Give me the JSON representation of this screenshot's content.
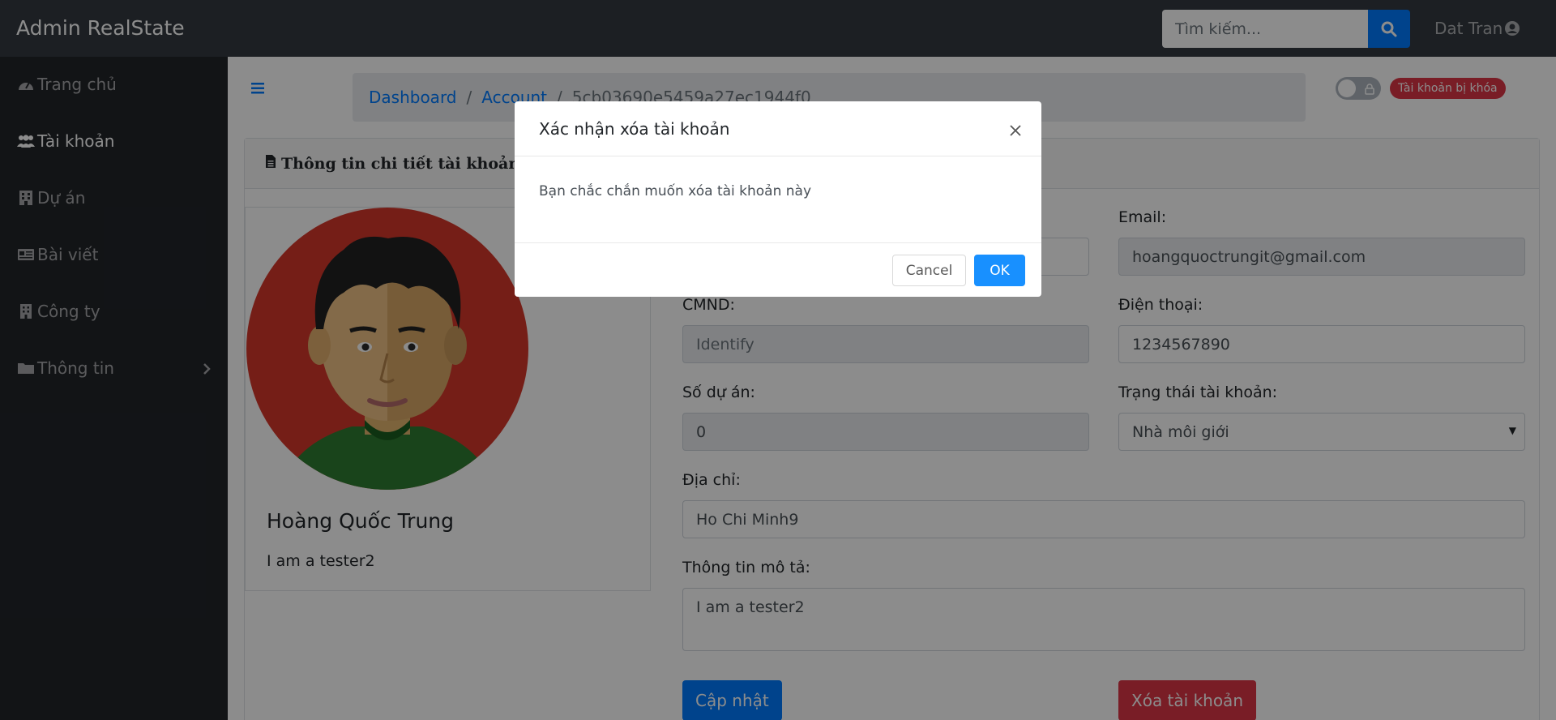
{
  "navbar": {
    "brand": "Admin RealState",
    "search_placeholder": "Tìm kiếm...",
    "user_name": "Dat Tran"
  },
  "sidebar": {
    "items": [
      {
        "label": "Trang chủ",
        "icon": "tachometer-icon"
      },
      {
        "label": "Tài khoản",
        "icon": "users-icon",
        "active": true
      },
      {
        "label": "Dự án",
        "icon": "building-icon"
      },
      {
        "label": "Bài viết",
        "icon": "newspaper-icon"
      },
      {
        "label": "Công ty",
        "icon": "company-icon"
      },
      {
        "label": "Thông tin",
        "icon": "folder-icon",
        "has_submenu": true
      }
    ]
  },
  "breadcrumb": {
    "items": [
      "Dashboard",
      "Account"
    ],
    "current": "5cb03690e5459a27ec1944f0"
  },
  "status_badge": "Tài khoản bị khóa",
  "card": {
    "title": "Thông tin chi tiết tài khoản"
  },
  "profile": {
    "name": "Hoàng Quốc Trung",
    "description": "I am a tester2"
  },
  "form": {
    "email_label": "Email:",
    "email_value": "hoangquoctrungit@gmail.com",
    "cmnd_label": "CMND:",
    "cmnd_placeholder": "Identify",
    "phone_label": "Điện thoại:",
    "phone_value": "1234567890",
    "projects_label": "Số dự án:",
    "projects_value": "0",
    "status_label": "Trạng thái tài khoản:",
    "status_value": "Nhà môi giới",
    "address_label": "Địa chỉ:",
    "address_value": "Ho Chi Minh9",
    "desc_label": "Thông tin mô tả:",
    "desc_value": "I am a tester2",
    "update_button": "Cập nhật",
    "delete_button": "Xóa tài khoản"
  },
  "modal": {
    "title": "Xác nhận xóa tài khoản",
    "body": "Bạn chắc chắn muốn xóa tài khoản này",
    "cancel": "Cancel",
    "ok": "OK"
  },
  "colors": {
    "navbar_bg": "#343a40",
    "sidebar_bg": "#212529",
    "primary": "#007bff",
    "danger": "#dc3545",
    "modal_ok": "#1890ff"
  }
}
